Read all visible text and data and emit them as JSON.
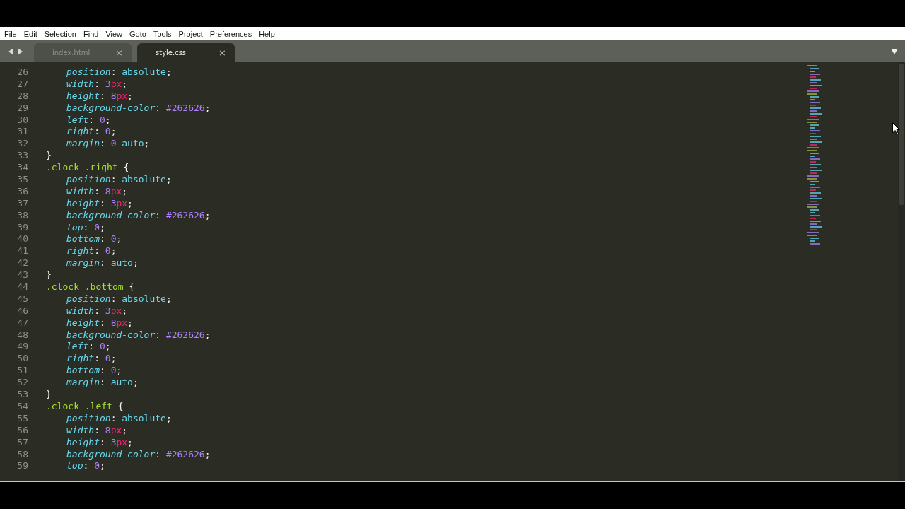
{
  "menu": [
    "File",
    "Edit",
    "Selection",
    "Find",
    "View",
    "Goto",
    "Tools",
    "Project",
    "Preferences",
    "Help"
  ],
  "tabs": [
    {
      "label": "index.html",
      "close": "×",
      "selected": false
    },
    {
      "label": "style.css",
      "close": "×",
      "selected": true
    }
  ],
  "editor": {
    "lines": [
      {
        "number": "26",
        "kind": "decl",
        "tokens": [
          {
            "kind": "property",
            "text": "position"
          },
          {
            "kind": "punct",
            "text": ": "
          },
          {
            "kind": "keyword",
            "text": "absolute"
          },
          {
            "kind": "punct",
            "text": ";"
          }
        ]
      },
      {
        "number": "27",
        "kind": "decl",
        "tokens": [
          {
            "kind": "property",
            "text": "width"
          },
          {
            "kind": "punct",
            "text": ": "
          },
          {
            "kind": "number",
            "text": "3"
          },
          {
            "kind": "unit",
            "text": "px"
          },
          {
            "kind": "punct",
            "text": ";"
          }
        ]
      },
      {
        "number": "28",
        "kind": "decl",
        "tokens": [
          {
            "kind": "property",
            "text": "height"
          },
          {
            "kind": "punct",
            "text": ": "
          },
          {
            "kind": "number",
            "text": "8"
          },
          {
            "kind": "unit",
            "text": "px"
          },
          {
            "kind": "punct",
            "text": ";"
          }
        ]
      },
      {
        "number": "29",
        "kind": "decl",
        "tokens": [
          {
            "kind": "property",
            "text": "background-color"
          },
          {
            "kind": "punct",
            "text": ": "
          },
          {
            "kind": "number",
            "text": "#262626"
          },
          {
            "kind": "punct",
            "text": ";"
          }
        ]
      },
      {
        "number": "30",
        "kind": "decl",
        "tokens": [
          {
            "kind": "property",
            "text": "left"
          },
          {
            "kind": "punct",
            "text": ": "
          },
          {
            "kind": "number",
            "text": "0"
          },
          {
            "kind": "punct",
            "text": ";"
          }
        ]
      },
      {
        "number": "31",
        "kind": "decl",
        "tokens": [
          {
            "kind": "property",
            "text": "right"
          },
          {
            "kind": "punct",
            "text": ": "
          },
          {
            "kind": "number",
            "text": "0"
          },
          {
            "kind": "punct",
            "text": ";"
          }
        ]
      },
      {
        "number": "32",
        "kind": "decl",
        "tokens": [
          {
            "kind": "property",
            "text": "margin"
          },
          {
            "kind": "punct",
            "text": ": "
          },
          {
            "kind": "number",
            "text": "0"
          },
          {
            "kind": "keyword",
            "text": " auto"
          },
          {
            "kind": "punct",
            "text": ";"
          }
        ]
      },
      {
        "number": "33",
        "kind": "rule",
        "tokens": [
          {
            "kind": "punct",
            "text": "}"
          }
        ]
      },
      {
        "number": "34",
        "kind": "rule",
        "tokens": [
          {
            "kind": "selector",
            "text": ".clock .right"
          },
          {
            "kind": "punct",
            "text": " {"
          }
        ]
      },
      {
        "number": "35",
        "kind": "decl",
        "tokens": [
          {
            "kind": "property",
            "text": "position"
          },
          {
            "kind": "punct",
            "text": ": "
          },
          {
            "kind": "keyword",
            "text": "absolute"
          },
          {
            "kind": "punct",
            "text": ";"
          }
        ]
      },
      {
        "number": "36",
        "kind": "decl",
        "tokens": [
          {
            "kind": "property",
            "text": "width"
          },
          {
            "kind": "punct",
            "text": ": "
          },
          {
            "kind": "number",
            "text": "8"
          },
          {
            "kind": "unit",
            "text": "px"
          },
          {
            "kind": "punct",
            "text": ";"
          }
        ]
      },
      {
        "number": "37",
        "kind": "decl",
        "tokens": [
          {
            "kind": "property",
            "text": "height"
          },
          {
            "kind": "punct",
            "text": ": "
          },
          {
            "kind": "number",
            "text": "3"
          },
          {
            "kind": "unit",
            "text": "px"
          },
          {
            "kind": "punct",
            "text": ";"
          }
        ]
      },
      {
        "number": "38",
        "kind": "decl",
        "tokens": [
          {
            "kind": "property",
            "text": "background-color"
          },
          {
            "kind": "punct",
            "text": ": "
          },
          {
            "kind": "number",
            "text": "#262626"
          },
          {
            "kind": "punct",
            "text": ";"
          }
        ]
      },
      {
        "number": "39",
        "kind": "decl",
        "tokens": [
          {
            "kind": "property",
            "text": "top"
          },
          {
            "kind": "punct",
            "text": ": "
          },
          {
            "kind": "number",
            "text": "0"
          },
          {
            "kind": "punct",
            "text": ";"
          }
        ]
      },
      {
        "number": "40",
        "kind": "decl",
        "tokens": [
          {
            "kind": "property",
            "text": "bottom"
          },
          {
            "kind": "punct",
            "text": ": "
          },
          {
            "kind": "number",
            "text": "0"
          },
          {
            "kind": "punct",
            "text": ";"
          }
        ]
      },
      {
        "number": "41",
        "kind": "decl",
        "tokens": [
          {
            "kind": "property",
            "text": "right"
          },
          {
            "kind": "punct",
            "text": ": "
          },
          {
            "kind": "number",
            "text": "0"
          },
          {
            "kind": "punct",
            "text": ";"
          }
        ]
      },
      {
        "number": "42",
        "kind": "decl",
        "tokens": [
          {
            "kind": "property",
            "text": "margin"
          },
          {
            "kind": "punct",
            "text": ": "
          },
          {
            "kind": "keyword",
            "text": "auto"
          },
          {
            "kind": "punct",
            "text": ";"
          }
        ]
      },
      {
        "number": "43",
        "kind": "rule",
        "tokens": [
          {
            "kind": "punct",
            "text": "}"
          }
        ]
      },
      {
        "number": "44",
        "kind": "rule",
        "tokens": [
          {
            "kind": "selector",
            "text": ".clock .bottom"
          },
          {
            "kind": "punct",
            "text": " {"
          }
        ]
      },
      {
        "number": "45",
        "kind": "decl",
        "tokens": [
          {
            "kind": "property",
            "text": "position"
          },
          {
            "kind": "punct",
            "text": ": "
          },
          {
            "kind": "keyword",
            "text": "absolute"
          },
          {
            "kind": "punct",
            "text": ";"
          }
        ]
      },
      {
        "number": "46",
        "kind": "decl",
        "tokens": [
          {
            "kind": "property",
            "text": "width"
          },
          {
            "kind": "punct",
            "text": ": "
          },
          {
            "kind": "number",
            "text": "3"
          },
          {
            "kind": "unit",
            "text": "px"
          },
          {
            "kind": "punct",
            "text": ";"
          }
        ]
      },
      {
        "number": "47",
        "kind": "decl",
        "tokens": [
          {
            "kind": "property",
            "text": "height"
          },
          {
            "kind": "punct",
            "text": ": "
          },
          {
            "kind": "number",
            "text": "8"
          },
          {
            "kind": "unit",
            "text": "px"
          },
          {
            "kind": "punct",
            "text": ";"
          }
        ]
      },
      {
        "number": "48",
        "kind": "decl",
        "tokens": [
          {
            "kind": "property",
            "text": "background-color"
          },
          {
            "kind": "punct",
            "text": ": "
          },
          {
            "kind": "number",
            "text": "#262626"
          },
          {
            "kind": "punct",
            "text": ";"
          }
        ]
      },
      {
        "number": "49",
        "kind": "decl",
        "tokens": [
          {
            "kind": "property",
            "text": "left"
          },
          {
            "kind": "punct",
            "text": ": "
          },
          {
            "kind": "number",
            "text": "0"
          },
          {
            "kind": "punct",
            "text": ";"
          }
        ]
      },
      {
        "number": "50",
        "kind": "decl",
        "tokens": [
          {
            "kind": "property",
            "text": "right"
          },
          {
            "kind": "punct",
            "text": ": "
          },
          {
            "kind": "number",
            "text": "0"
          },
          {
            "kind": "punct",
            "text": ";"
          }
        ]
      },
      {
        "number": "51",
        "kind": "decl",
        "tokens": [
          {
            "kind": "property",
            "text": "bottom"
          },
          {
            "kind": "punct",
            "text": ": "
          },
          {
            "kind": "number",
            "text": "0"
          },
          {
            "kind": "punct",
            "text": ";"
          }
        ]
      },
      {
        "number": "52",
        "kind": "decl",
        "tokens": [
          {
            "kind": "property",
            "text": "margin"
          },
          {
            "kind": "punct",
            "text": ": "
          },
          {
            "kind": "keyword",
            "text": "auto"
          },
          {
            "kind": "punct",
            "text": ";"
          }
        ]
      },
      {
        "number": "53",
        "kind": "rule",
        "tokens": [
          {
            "kind": "punct",
            "text": "}"
          }
        ]
      },
      {
        "number": "54",
        "kind": "rule",
        "tokens": [
          {
            "kind": "selector",
            "text": ".clock .left"
          },
          {
            "kind": "punct",
            "text": " {"
          }
        ]
      },
      {
        "number": "55",
        "kind": "decl",
        "tokens": [
          {
            "kind": "property",
            "text": "position"
          },
          {
            "kind": "punct",
            "text": ": "
          },
          {
            "kind": "keyword",
            "text": "absolute"
          },
          {
            "kind": "punct",
            "text": ";"
          }
        ]
      },
      {
        "number": "56",
        "kind": "decl",
        "tokens": [
          {
            "kind": "property",
            "text": "width"
          },
          {
            "kind": "punct",
            "text": ": "
          },
          {
            "kind": "number",
            "text": "8"
          },
          {
            "kind": "unit",
            "text": "px"
          },
          {
            "kind": "punct",
            "text": ";"
          }
        ]
      },
      {
        "number": "57",
        "kind": "decl",
        "tokens": [
          {
            "kind": "property",
            "text": "height"
          },
          {
            "kind": "punct",
            "text": ": "
          },
          {
            "kind": "number",
            "text": "3"
          },
          {
            "kind": "unit",
            "text": "px"
          },
          {
            "kind": "punct",
            "text": ";"
          }
        ]
      },
      {
        "number": "58",
        "kind": "decl",
        "tokens": [
          {
            "kind": "property",
            "text": "background-color"
          },
          {
            "kind": "punct",
            "text": ": "
          },
          {
            "kind": "number",
            "text": "#262626"
          },
          {
            "kind": "punct",
            "text": ";"
          }
        ]
      },
      {
        "number": "59",
        "kind": "decl",
        "tokens": [
          {
            "kind": "property",
            "text": "top"
          },
          {
            "kind": "punct",
            "text": ": "
          },
          {
            "kind": "number",
            "text": "0"
          },
          {
            "kind": "punct",
            "text": ";"
          }
        ]
      }
    ]
  }
}
